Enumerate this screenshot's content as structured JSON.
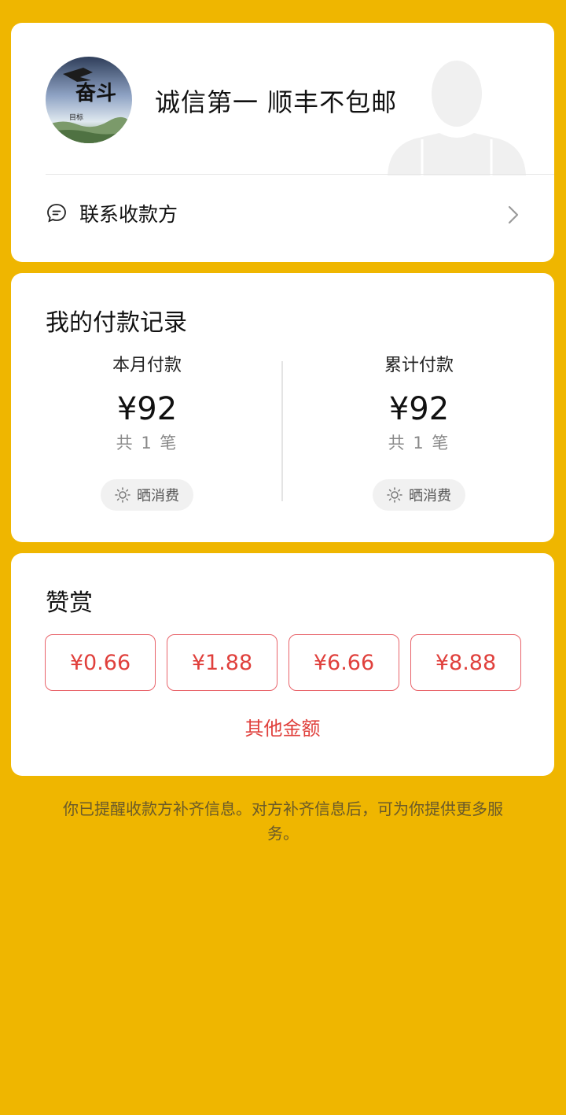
{
  "merchant": {
    "name": "诚信第一 顺丰不包邮",
    "avatar_text": "奋斗",
    "avatar_caption": "目标",
    "contact_label": "联系收款方"
  },
  "records": {
    "title": "我的付款记录",
    "month": {
      "label": "本月付款",
      "amount": "¥92",
      "count": "共 1 笔",
      "share_label": "晒消费"
    },
    "total": {
      "label": "累计付款",
      "amount": "¥92",
      "count": "共 1 笔",
      "share_label": "晒消费"
    }
  },
  "reward": {
    "title": "赞赏",
    "options": [
      "¥0.66",
      "¥1.88",
      "¥6.66",
      "¥8.88"
    ],
    "other_label": "其他金额"
  },
  "note": "你已提醒收款方补齐信息。对方补齐信息后，可为你提供更多服务。",
  "colors": {
    "background": "#EFB600",
    "accent_red": "#E0403C",
    "card": "#FFFFFF"
  }
}
